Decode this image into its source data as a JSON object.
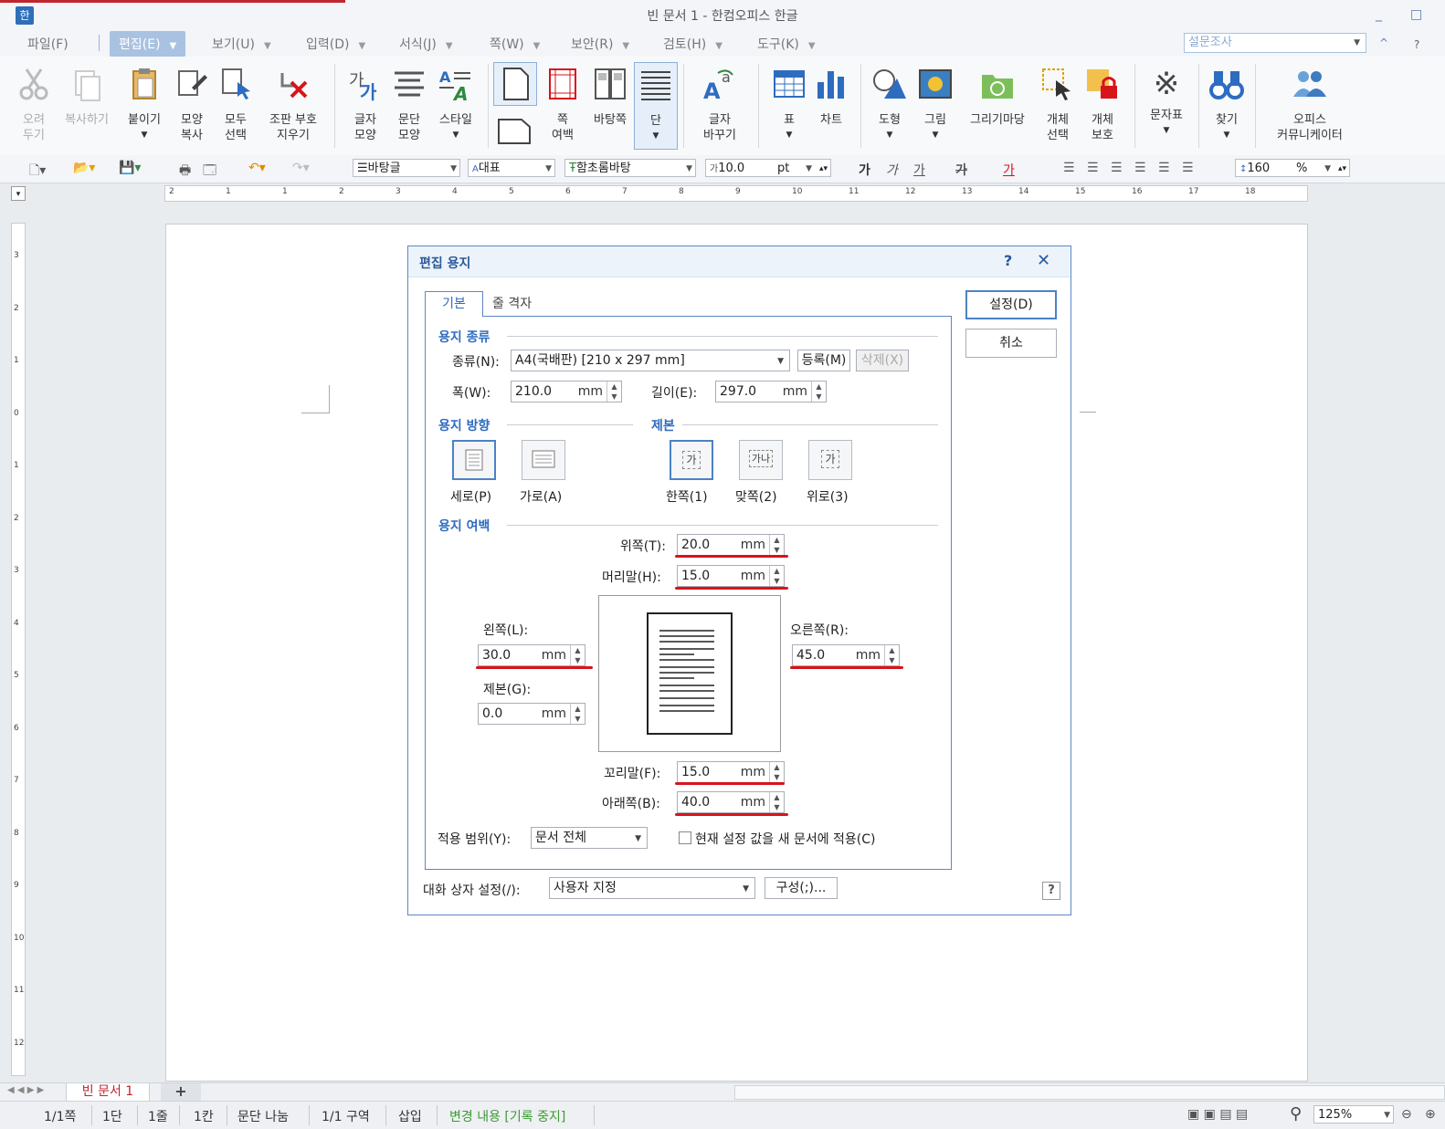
{
  "window": {
    "title": "빈 문서 1 - 한컴오피스 한글",
    "min_symbol": "_",
    "max_symbol": "□",
    "help_symbol": "?",
    "ribbon_collapse": "^"
  },
  "menu": {
    "items": [
      {
        "label": "파일(F)"
      },
      {
        "label": "편집(E)"
      },
      {
        "label": "보기(U)"
      },
      {
        "label": "입력(D)"
      },
      {
        "label": "서식(J)"
      },
      {
        "label": "쪽(W)"
      },
      {
        "label": "보안(R)"
      },
      {
        "label": "검토(H)"
      },
      {
        "label": "도구(K)"
      }
    ],
    "survey": "설문조사"
  },
  "ribbon": {
    "cut": "오려\n두기",
    "copy": "복사하기",
    "paste": "붙이기",
    "format_copy": "모양\n복사",
    "select_all": "모두\n선택",
    "clear_marks": "조판 부호\n지우기",
    "char_shape": "글자\n모양",
    "para_shape": "문단\n모양",
    "style": "스타일",
    "page_margin": "쪽\n여백",
    "master_page": "바탕쪽",
    "column": "단",
    "change_char": "글자\n바꾸기",
    "table": "표",
    "chart": "차트",
    "shape": "도형",
    "picture": "그림",
    "drawing_market": "그리기마당",
    "obj_select": "개체\n선택",
    "obj_protect": "개체\n보호",
    "symbols": "문자표",
    "find": "찾기",
    "communicator": "오피스\n커뮤니케이터"
  },
  "toolbar": {
    "style_value": "바탕글",
    "lang_value": "대표",
    "font_value": "함초롬바탕",
    "size_value": "10.0",
    "size_unit": "pt",
    "bold": "가",
    "italic": "가",
    "underline": "가",
    "strike": "가",
    "color": "가",
    "line_spacing": "160",
    "line_spacing_unit": "%"
  },
  "ruler": {
    "h_ticks": [
      "2",
      "1",
      "1",
      "2",
      "3",
      "4",
      "5",
      "6",
      "7",
      "8",
      "9",
      "10",
      "11",
      "12",
      "13",
      "14",
      "15",
      "16",
      "17",
      "18"
    ],
    "v_ticks": [
      "3",
      "2",
      "1",
      "0",
      "1",
      "2",
      "3",
      "4",
      "5",
      "6",
      "7",
      "8",
      "9",
      "10",
      "11",
      "12"
    ]
  },
  "dialog": {
    "title": "편집 용지",
    "help": "?",
    "close": "✕",
    "tabs": [
      "기본",
      "줄 격자"
    ],
    "ok": "설정(D)",
    "cancel": "취소",
    "paper_type": {
      "section": "용지 종류",
      "type_label": "종류(N):",
      "type_value": "A4(국배판)  [210 x 297 mm]",
      "register": "등록(M)",
      "delete": "삭제(X)",
      "width_label": "폭(W):",
      "width_value": "210.0",
      "length_label": "길이(E):",
      "length_value": "297.0",
      "unit": "mm"
    },
    "orientation": {
      "section": "용지 방향",
      "portrait": "세로(P)",
      "landscape": "가로(A)"
    },
    "binding": {
      "section": "제본",
      "one_side": "한쪽(1)",
      "facing": "맞쪽(2)",
      "top": "위로(3)",
      "one_side_glyph": "가",
      "facing_glyph": "가나",
      "top_glyph": "가"
    },
    "margins": {
      "section": "용지 여백",
      "top_label": "위쪽(T):",
      "top_value": "20.0",
      "header_label": "머리말(H):",
      "header_value": "15.0",
      "left_label": "왼쪽(L):",
      "left_value": "30.0",
      "right_label": "오른쪽(R):",
      "right_value": "45.0",
      "gutter_label": "제본(G):",
      "gutter_value": "0.0",
      "footer_label": "꼬리말(F):",
      "footer_value": "15.0",
      "bottom_label": "아래쪽(B):",
      "bottom_value": "40.0",
      "unit": "mm"
    },
    "apply": {
      "label": "적용 범위(Y):",
      "value": "문서 전체",
      "checkbox_label": "현재 설정 값을 새 문서에 적용(C)",
      "checked": false
    },
    "dialog_settings_label": "대화 상자 설정(/):",
    "dialog_settings_value": "사용자 지정",
    "config_button": "구성(;)...",
    "help_corner": "?"
  },
  "sheet_tabs": {
    "active": "빈 문서 1",
    "add": "+"
  },
  "status": {
    "page": "1/1쪽",
    "column": "1단",
    "line": "1줄",
    "col": "1칸",
    "para_break": "문단 나눔",
    "section": "1/1 구역",
    "insert": "삽입",
    "track": "변경 내용 [기록 중지]",
    "zoom": "125%"
  },
  "colors": {
    "accent": "#2e6cc0",
    "annotation_red": "#d7141a",
    "track_green": "#3c9a34",
    "tab_red": "#c0262d"
  }
}
